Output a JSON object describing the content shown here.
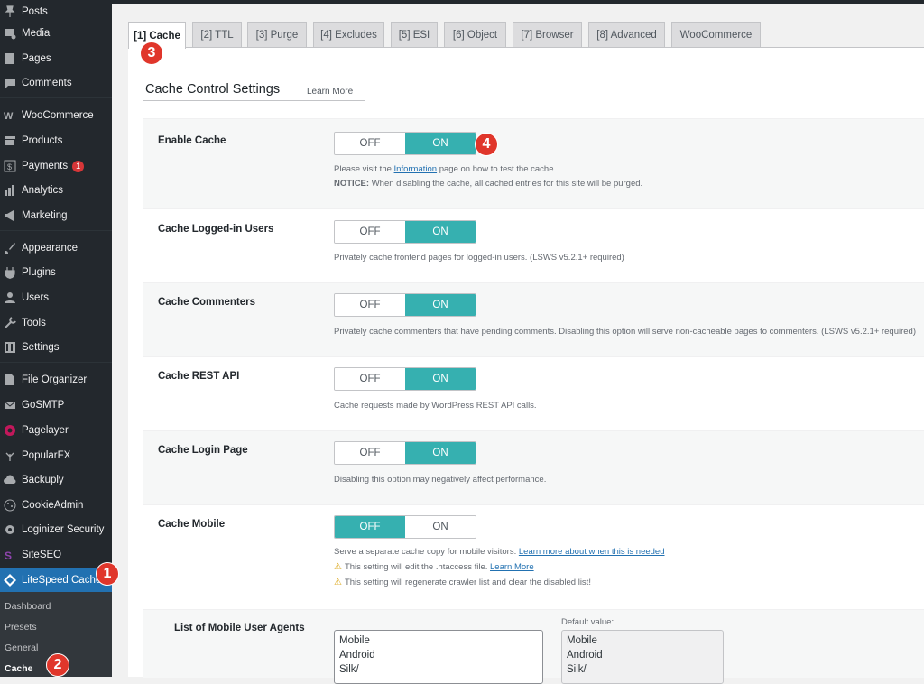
{
  "sidebar": {
    "items": [
      {
        "label": "Posts",
        "icon": "pin-icon"
      },
      {
        "label": "Media",
        "icon": "media-icon"
      },
      {
        "label": "Pages",
        "icon": "page-icon"
      },
      {
        "label": "Comments",
        "icon": "comment-icon"
      },
      {
        "label": "WooCommerce",
        "icon": "woo-icon"
      },
      {
        "label": "Products",
        "icon": "archive-icon"
      },
      {
        "label": "Payments",
        "icon": "dollar-icon",
        "badge": "1"
      },
      {
        "label": "Analytics",
        "icon": "bar-chart-icon"
      },
      {
        "label": "Marketing",
        "icon": "megaphone-icon"
      },
      {
        "label": "Appearance",
        "icon": "brush-icon"
      },
      {
        "label": "Plugins",
        "icon": "plug-icon"
      },
      {
        "label": "Users",
        "icon": "user-icon"
      },
      {
        "label": "Tools",
        "icon": "wrench-icon"
      },
      {
        "label": "Settings",
        "icon": "settings-icon"
      },
      {
        "label": "File Organizer",
        "icon": "file-icon"
      },
      {
        "label": "GoSMTP",
        "icon": "mail-icon"
      },
      {
        "label": "Pagelayer",
        "icon": "pagelayer-icon"
      },
      {
        "label": "PopularFX",
        "icon": "leaf-icon"
      },
      {
        "label": "Backuply",
        "icon": "cloud-upload-icon"
      },
      {
        "label": "CookieAdmin",
        "icon": "cookie-icon"
      },
      {
        "label": "Loginizer Security",
        "icon": "gear-icon"
      },
      {
        "label": "SiteSEO",
        "icon": "siteseo-icon"
      },
      {
        "label": "LiteSpeed Cache",
        "icon": "diamond-icon"
      }
    ],
    "submenu": [
      "Dashboard",
      "Presets",
      "General",
      "Cache"
    ]
  },
  "tabs": [
    "[1] Cache",
    "[2] TTL",
    "[3] Purge",
    "[4] Excludes",
    "[5] ESI",
    "[6] Object",
    "[7] Browser",
    "[8] Advanced",
    "WooCommerce"
  ],
  "section": {
    "title": "Cache Control Settings",
    "learn_more": "Learn More"
  },
  "toggle_labels": {
    "off": "OFF",
    "on": "ON"
  },
  "settings": {
    "enable_cache": {
      "label": "Enable Cache",
      "value": "ON",
      "desc_before": "Please visit the ",
      "desc_link": "Information",
      "desc_after": " page on how to test the cache.",
      "notice_label": "NOTICE:",
      "notice_text": " When disabling the cache, all cached entries for this site will be purged."
    },
    "logged_in": {
      "label": "Cache Logged-in Users",
      "value": "ON",
      "desc": "Privately cache frontend pages for logged-in users. (LSWS v5.2.1+ required)"
    },
    "commenters": {
      "label": "Cache Commenters",
      "value": "ON",
      "desc": "Privately cache commenters that have pending comments. Disabling this option will serve non-cacheable pages to commenters. (LSWS v5.2.1+ required)"
    },
    "rest_api": {
      "label": "Cache REST API",
      "value": "ON",
      "desc": "Cache requests made by WordPress REST API calls."
    },
    "login_page": {
      "label": "Cache Login Page",
      "value": "ON",
      "desc": "Disabling this option may negatively affect performance."
    },
    "mobile": {
      "label": "Cache Mobile",
      "value": "OFF",
      "desc": "Serve a separate cache copy for mobile visitors. ",
      "desc_link": "Learn more about when this is needed",
      "warn1": "This setting will edit the .htaccess file. ",
      "warn1_link": "Learn More",
      "warn2": "This setting will regenerate crawler list and clear the disabled list!"
    },
    "mobile_agents": {
      "label": "List of Mobile User Agents",
      "values": [
        "Mobile",
        "Android",
        "Silk/"
      ],
      "default_label": "Default value:",
      "default_values": [
        "Mobile",
        "Android",
        "Silk/"
      ]
    }
  },
  "markers": [
    "1",
    "2",
    "3",
    "4"
  ],
  "colors": {
    "accent_toggle": "#36b0b0",
    "admin_active": "#2271b1",
    "marker": "#e0362b"
  }
}
